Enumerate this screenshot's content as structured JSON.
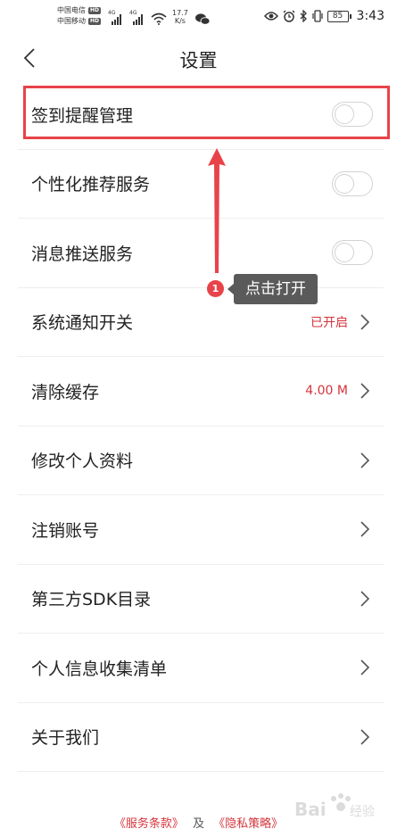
{
  "status_bar": {
    "carrier_1": "中国电信",
    "carrier_2": "中国移动",
    "hd_label": "HD",
    "network_1": "4G",
    "network_2": "4G",
    "speed_value": "17.7",
    "speed_unit": "K/s",
    "battery": "85",
    "time": "3:43"
  },
  "header": {
    "title": "设置",
    "back_icon": "chevron-left-icon"
  },
  "settings": {
    "items": [
      {
        "label": "签到提醒管理",
        "control": "toggle",
        "on": false
      },
      {
        "label": "个性化推荐服务",
        "control": "toggle",
        "on": false
      },
      {
        "label": "消息推送服务",
        "control": "toggle",
        "on": false
      },
      {
        "label": "系统通知开关",
        "value": "已开启",
        "control": "chevron"
      },
      {
        "label": "清除缓存",
        "value": "4.00 M",
        "control": "chevron"
      },
      {
        "label": "修改个人资料",
        "control": "chevron"
      },
      {
        "label": "注销账号",
        "control": "chevron"
      },
      {
        "label": "第三方SDK目录",
        "control": "chevron"
      },
      {
        "label": "个人信息收集清单",
        "control": "chevron"
      },
      {
        "label": "关于我们",
        "control": "chevron"
      }
    ]
  },
  "annotation": {
    "step_number": "1",
    "tooltip_text": "点击打开",
    "color": "#e8434a"
  },
  "footer": {
    "terms_link": "《服务条款》",
    "separator": "及",
    "privacy_link": "《隐私策略》"
  },
  "colors": {
    "accent_red": "#d4343b",
    "divider": "#eeeeee",
    "toggle_border": "#d2d2d2"
  }
}
